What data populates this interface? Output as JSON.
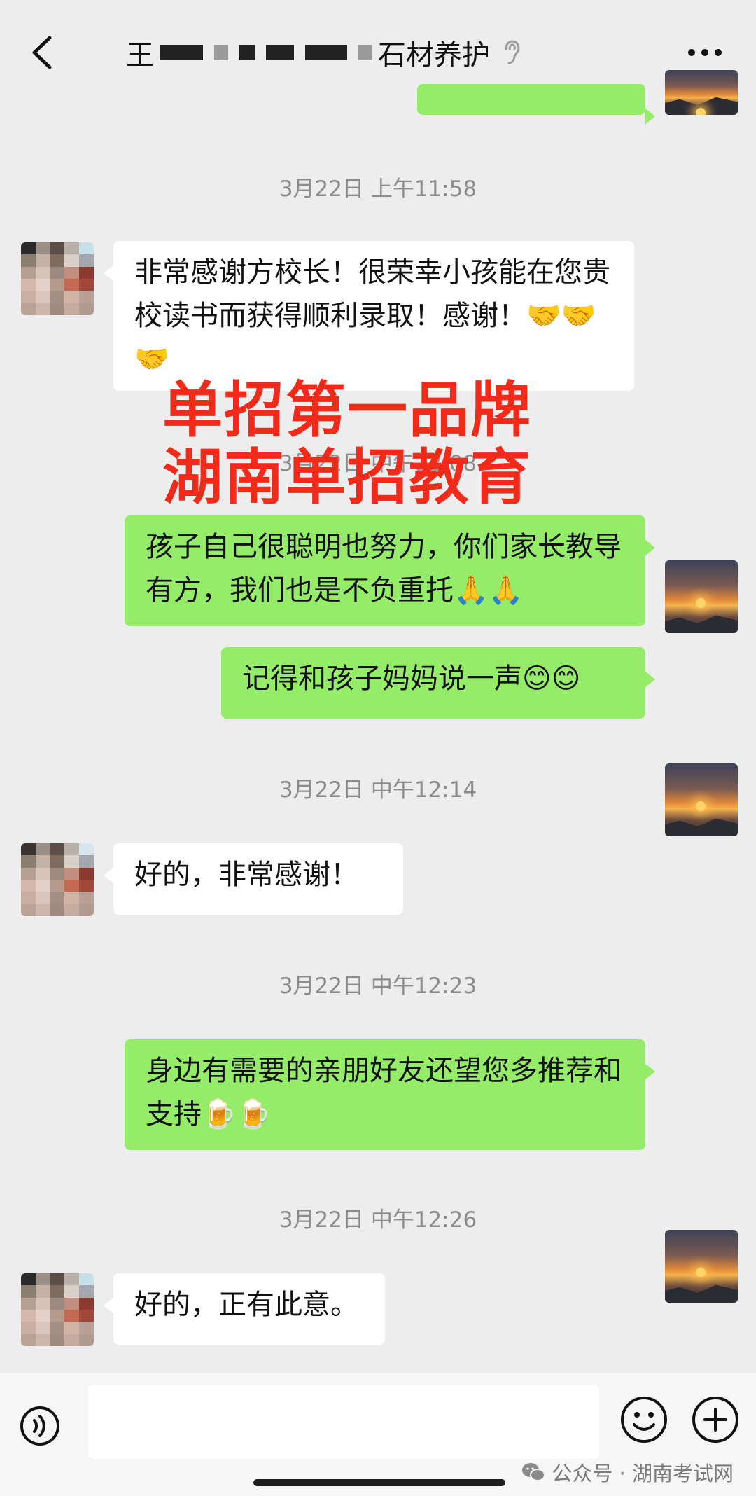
{
  "header": {
    "title_prefix": "王",
    "title_suffix": "石材养护"
  },
  "messages": [
    {
      "type": "timestamp",
      "text": "3月22日 上午11:58"
    },
    {
      "type": "left",
      "text": "非常感谢方校长！很荣幸小孩能在您贵校读书而获得顺利录取！感谢！🤝🤝🤝"
    },
    {
      "type": "timestamp",
      "text": "3月22日 中午12:08"
    },
    {
      "type": "right",
      "text": "孩子自己很聪明也努力，你们家长教导有方，我们也是不负重托🙏🙏"
    },
    {
      "type": "right",
      "text": "记得和孩子妈妈说一声😊😊"
    },
    {
      "type": "timestamp",
      "text": "3月22日 中午12:14"
    },
    {
      "type": "left",
      "text": "好的，非常感谢！"
    },
    {
      "type": "timestamp",
      "text": "3月22日 中午12:23"
    },
    {
      "type": "right",
      "text": "身边有需要的亲朋好友还望您多推荐和支持🍺🍺"
    },
    {
      "type": "timestamp",
      "text": "3月22日 中午12:26"
    },
    {
      "type": "left",
      "text": "好的，正有此意。"
    }
  ],
  "watermark": {
    "line1": "单招第一品牌",
    "line2": "湖南单招教育"
  },
  "input_bar": {
    "source": "公众号 · 湖南考试网"
  },
  "colors": {
    "background": "#ededed",
    "bubble_sent": "#95ec69",
    "bubble_received": "#ffffff",
    "watermark": "#f22a1a"
  },
  "icons": [
    "back-arrow-icon",
    "ear-icon",
    "more-icon",
    "voice-icon",
    "emoji-icon",
    "plus-icon",
    "wechat-icon"
  ]
}
